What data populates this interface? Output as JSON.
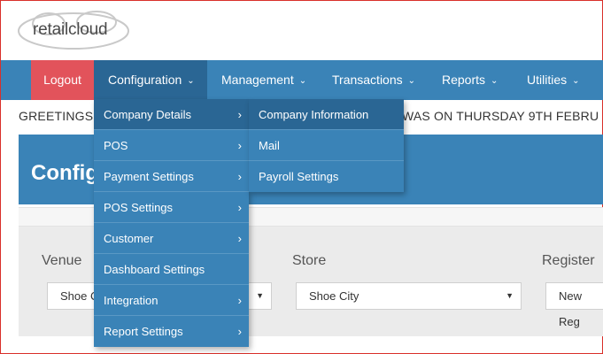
{
  "logo": {
    "text": "retailcloud"
  },
  "nav": {
    "logout": "Logout",
    "configuration": "Configuration",
    "management": "Management",
    "transactions": "Transactions",
    "reports": "Reports",
    "utilities": "Utilities",
    "chevron": "⌄"
  },
  "greeting": {
    "left": "GREETINGS",
    "right": "WAS ON THURSDAY 9TH FEBRU"
  },
  "banner": {
    "title": "Config"
  },
  "form": {
    "venue_label": "Venue",
    "venue_value": "Shoe C",
    "store_label": "Store",
    "store_value": "Shoe City",
    "register_label": "Register",
    "register_value": "New Reg"
  },
  "config_menu": [
    {
      "label": "Company Details",
      "has_sub": true,
      "active": true
    },
    {
      "label": "POS",
      "has_sub": true
    },
    {
      "label": "Payment Settings",
      "has_sub": true
    },
    {
      "label": "POS Settings",
      "has_sub": true
    },
    {
      "label": "Customer",
      "has_sub": true
    },
    {
      "label": "Dashboard Settings",
      "has_sub": false
    },
    {
      "label": "Integration",
      "has_sub": true
    },
    {
      "label": "Report Settings",
      "has_sub": true
    }
  ],
  "company_submenu": [
    {
      "label": "Company Information",
      "active": true
    },
    {
      "label": "Mail"
    },
    {
      "label": "Payroll Settings"
    }
  ],
  "icons": {
    "submenu_arrow": "›",
    "select_caret": "▼"
  }
}
